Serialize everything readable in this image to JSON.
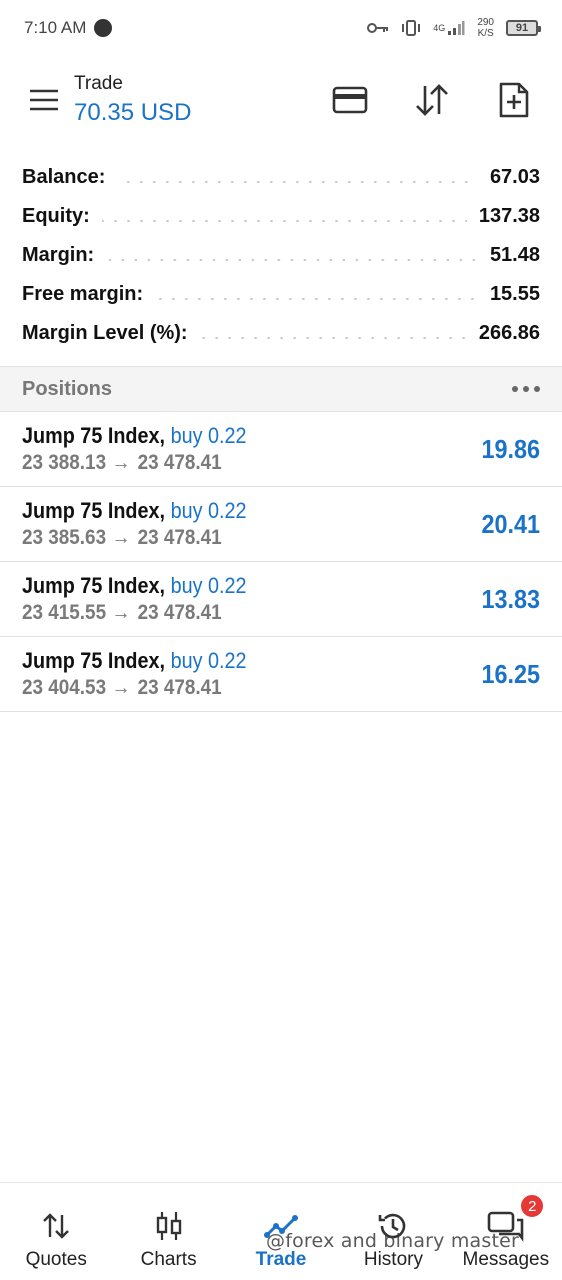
{
  "status_bar": {
    "time": "7:10 AM",
    "network": "4G",
    "net_speed_value": "290",
    "net_speed_unit": "K/S",
    "battery": "91"
  },
  "toolbar": {
    "title": "Trade",
    "balance_display": "70.35 USD",
    "icons": [
      "menu-icon",
      "credit-card-icon",
      "sort-arrows-icon",
      "new-order-icon"
    ]
  },
  "summary": {
    "balance_label": "Balance:",
    "balance_value": "67.03",
    "equity_label": "Equity:",
    "equity_value": "137.38",
    "margin_label": "Margin:",
    "margin_value": "51.48",
    "free_margin_label": "Free margin:",
    "free_margin_value": "15.55",
    "margin_level_label": "Margin Level (%):",
    "margin_level_value": "266.86"
  },
  "positions": {
    "title": "Positions",
    "items": [
      {
        "symbol": "Jump 75 Index,",
        "direction": "buy 0.22",
        "open_price": "23 388.13",
        "arrow": "→",
        "current_price": "23 478.41",
        "profit": "19.86"
      },
      {
        "symbol": "Jump 75 Index,",
        "direction": "buy 0.22",
        "open_price": "23 385.63",
        "arrow": "→",
        "current_price": "23 478.41",
        "profit": "20.41"
      },
      {
        "symbol": "Jump 75 Index,",
        "direction": "buy 0.22",
        "open_price": "23 415.55",
        "arrow": "→",
        "current_price": "23 478.41",
        "profit": "13.83"
      },
      {
        "symbol": "Jump 75 Index,",
        "direction": "buy 0.22",
        "open_price": "23 404.53",
        "arrow": "→",
        "current_price": "23 478.41",
        "profit": "16.25"
      }
    ]
  },
  "bottom_nav": {
    "items": [
      {
        "label": "Quotes",
        "icon": "quotes-icon"
      },
      {
        "label": "Charts",
        "icon": "charts-icon"
      },
      {
        "label": "Trade",
        "icon": "trade-icon",
        "active": true
      },
      {
        "label": "History",
        "icon": "history-icon"
      },
      {
        "label": "Messages",
        "icon": "messages-icon",
        "badge": "2"
      }
    ]
  },
  "watermark": "@forex and binary master",
  "colors": {
    "accent": "#1a73c8",
    "badge": "#e53935",
    "muted_text": "#7a7a7a"
  }
}
